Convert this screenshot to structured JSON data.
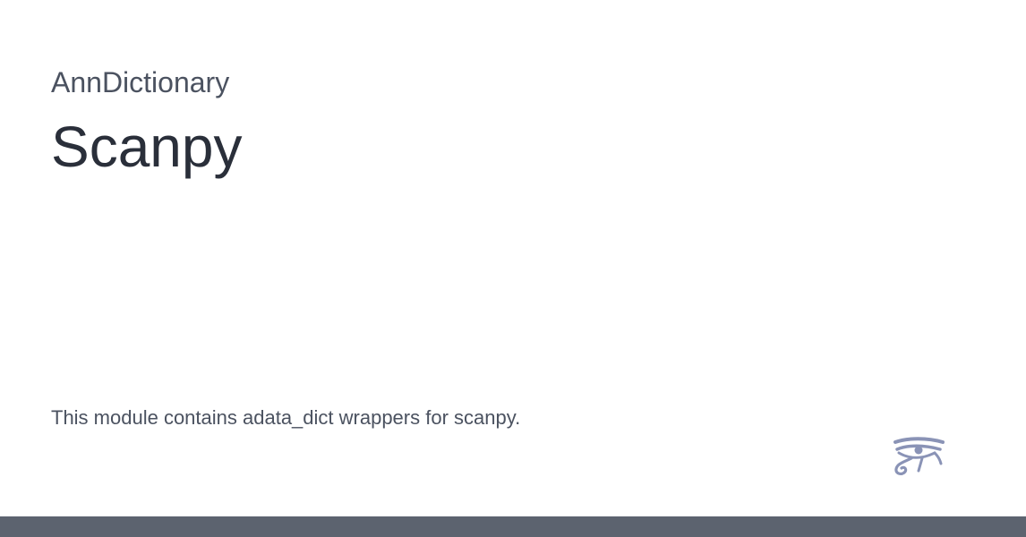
{
  "site": {
    "name": "AnnDictionary"
  },
  "page": {
    "title": "Scanpy",
    "description": "This module contains adata_dict wrappers for scanpy."
  },
  "branding": {
    "logo_icon": "eye-of-horus-icon",
    "logo_color": "#8a93b6",
    "footer_color": "#5c636f",
    "title_color": "#2a2f3a",
    "text_color": "#4b5260"
  }
}
